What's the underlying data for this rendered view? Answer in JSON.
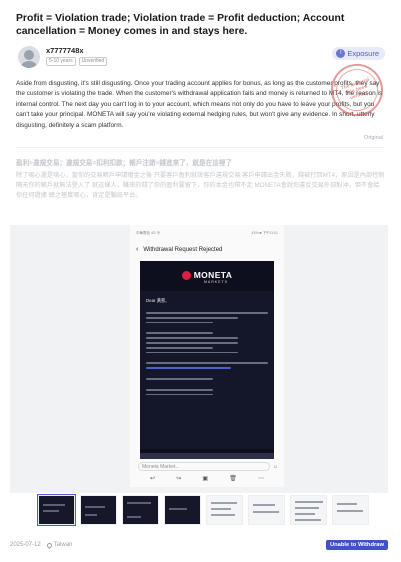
{
  "post": {
    "title": "Profit = Violation trade; Violation trade = Profit deduction; Account cancellation = Money comes in and stays here.",
    "body": "Aside from disgusting, it's still disgusting. Once your trading account applies for bonus, as long as the customer profits, they say the customer is violating the trade. When the customer's withdrawal application fails and money is returned to MT4, the reason is internal control. The next day you can't log in to your account, which means not only do you have to leave your profits, but you can't take your principal. MONETA will say you're violating external hedging rules, but won't give any evidence. In short, utterly disgusting, definitely a scam platform.",
    "original_label": "Original",
    "translated_title": "盈利=違規交易；違規交易=扣利扣款；帳戶注銷=錢進來了，就是在這裡了",
    "translated_body": "除了噁心還是噁心，當你的交易帳戶申請贈金之後 只要客戶盈利就說客戶違規交易 客戶申請出金失敗，錢被打回MT4，原因是內部控制 隔天你的帳戶就無法登入了 就這樣人，賺來的錢了你的盈利要留下，你的本金也帶不走 MONETA會說你違反交易外部對沖，但不會給你任何證據 總之極度噁心，肯定是騙局平台。",
    "date": "2025-07-12",
    "location": "Taiwan",
    "status_badge": "Unable to Withdraw"
  },
  "user": {
    "name": "x7777748x",
    "tag_years": "5-10 years",
    "tag_verified": "Unverified"
  },
  "exposure": {
    "label": "Exposure",
    "icon": "exposure-icon"
  },
  "stamp": {
    "line1": "The material",
    "line2": "has been",
    "line3": "verified"
  },
  "screenshot": {
    "status_left": "中華電信 4G 令",
    "status_right": "43% ■ 下午11:01",
    "header": "Withdrawal Request Rejected",
    "brand": "MONETA",
    "brand_sub": "MARKETS",
    "greeting": "Dear 黃凱,",
    "reply_placeholder": "Moneta Market..."
  },
  "colors": {
    "accent": "#4152c6",
    "exposure_bg": "#e8eaf9",
    "stamp": "#d24646",
    "email_bg": "#14162a",
    "brand_red": "#e01d40"
  }
}
